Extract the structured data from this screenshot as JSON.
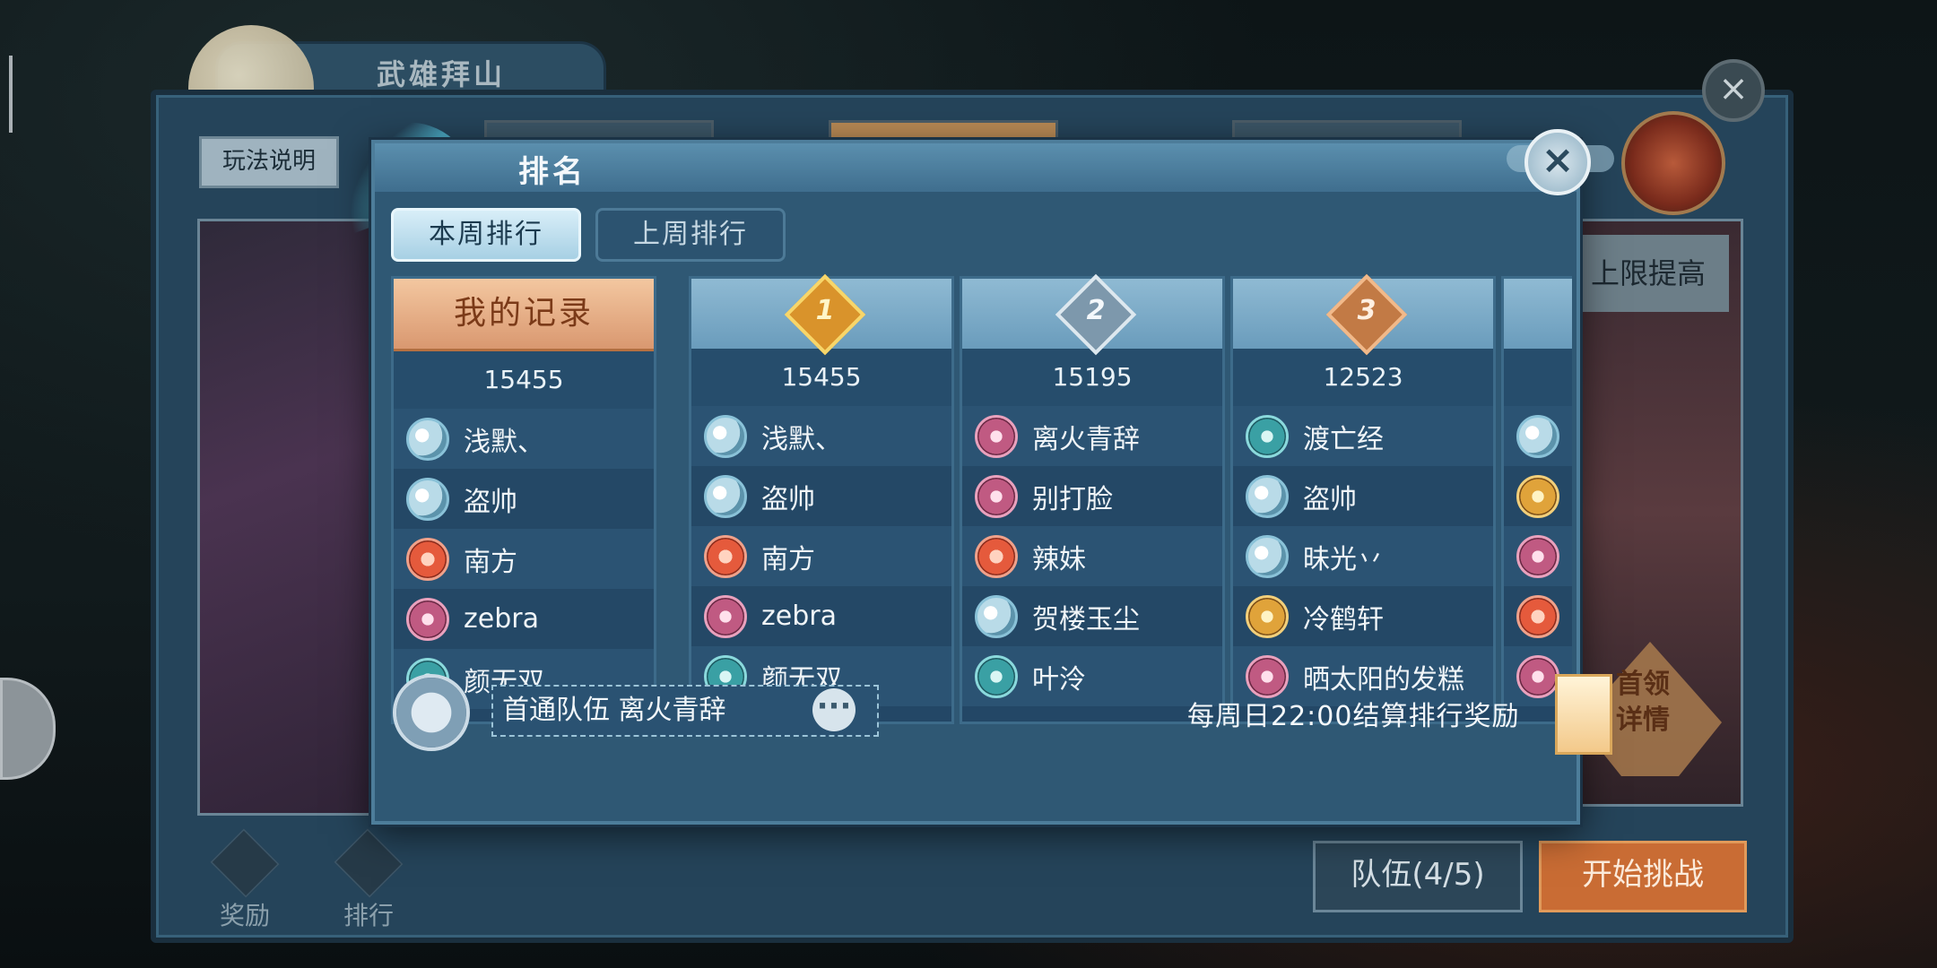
{
  "outer": {
    "title": "武雄拜山",
    "help_label": "玩法说明",
    "right_label": "上限提高",
    "leader_label": "首领详情",
    "team_label": "队伍(4/5)",
    "start_label": "开始挑战",
    "reward_label": "奖励",
    "rank_label": "排行"
  },
  "modal": {
    "title": "排名",
    "tabs": [
      {
        "label": "本周排行",
        "active": true
      },
      {
        "label": "上周排行",
        "active": false
      }
    ],
    "my_record": {
      "label": "我的记录",
      "score": "15455",
      "members": [
        {
          "name": "浅默、",
          "icon": "taiji"
        },
        {
          "name": "盗帅",
          "icon": "taiji"
        },
        {
          "name": "南方",
          "icon": "fire"
        },
        {
          "name": "zebra",
          "icon": "blade"
        },
        {
          "name": "颜无双",
          "icon": "sword"
        }
      ]
    },
    "ranks": [
      {
        "rank": "1",
        "badge": "gold",
        "score": "15455",
        "members": [
          {
            "name": "浅默、",
            "icon": "taiji"
          },
          {
            "name": "盗帅",
            "icon": "taiji"
          },
          {
            "name": "南方",
            "icon": "fire"
          },
          {
            "name": "zebra",
            "icon": "blade"
          },
          {
            "name": "颜无双",
            "icon": "sword"
          }
        ]
      },
      {
        "rank": "2",
        "badge": "silver",
        "score": "15195",
        "members": [
          {
            "name": "离火青辞",
            "icon": "blade"
          },
          {
            "name": "别打脸",
            "icon": "blade"
          },
          {
            "name": "辣妹",
            "icon": "fire"
          },
          {
            "name": "贺楼玉尘",
            "icon": "taiji"
          },
          {
            "name": "叶泠",
            "icon": "sword"
          }
        ]
      },
      {
        "rank": "3",
        "badge": "bronze",
        "score": "12523",
        "members": [
          {
            "name": "渡亡经",
            "icon": "sword"
          },
          {
            "name": "盗帅",
            "icon": "taiji"
          },
          {
            "name": "昧光丷",
            "icon": "taiji"
          },
          {
            "name": "冷鹤轩",
            "icon": "swirl"
          },
          {
            "name": "晒太阳的发糕",
            "icon": "blade"
          }
        ]
      }
    ],
    "partial_column_icons": [
      "taiji",
      "swirl",
      "blade",
      "fire",
      "blade"
    ],
    "first_team": "首通队伍  离火青辞",
    "more": "···",
    "settle_text": "每周日22:00结算排行奖励"
  }
}
